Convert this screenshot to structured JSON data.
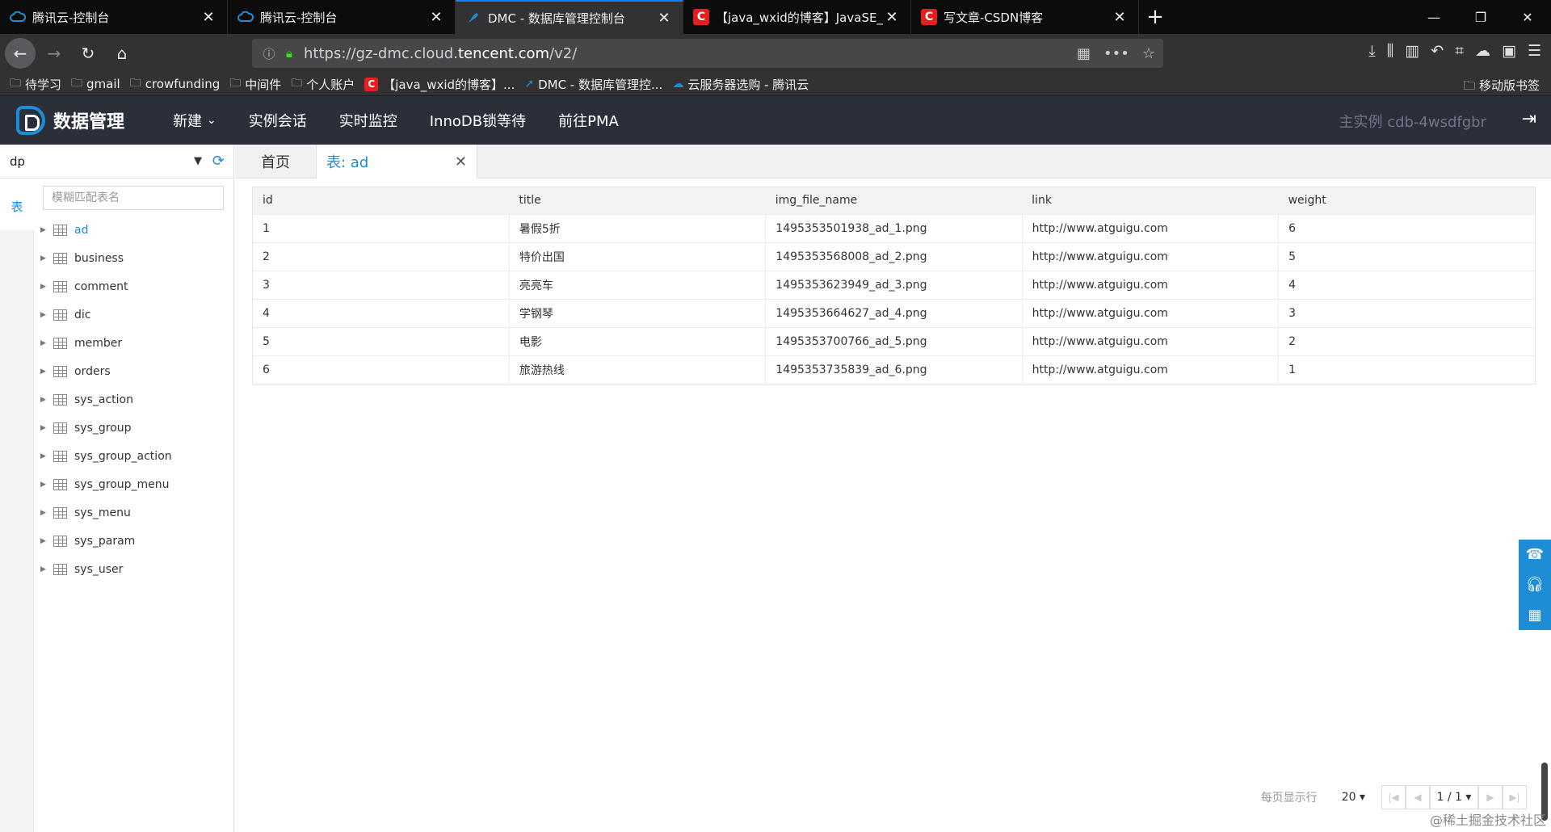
{
  "browser": {
    "tabs": [
      {
        "label": "腾讯云-控制台",
        "icon": "cloud-icon"
      },
      {
        "label": "腾讯云-控制台",
        "icon": "cloud-icon"
      },
      {
        "label": "DMC - 数据库管理控制台",
        "icon": "dmc-icon"
      },
      {
        "label": "【java_wxid的博客】JavaSE_N",
        "icon": "csdn-icon"
      },
      {
        "label": "写文章-CSDN博客",
        "icon": "csdn-icon"
      }
    ],
    "url_prefix": "https://gz-dmc.cloud.",
    "url_domain": "tencent.com",
    "url_suffix": "/v2/",
    "bookmarks": [
      "待学习",
      "gmail",
      "crowfunding",
      "中间件",
      "个人账户",
      "【java_wxid的博客】...",
      "DMC - 数据库管理控...",
      "云服务器选购 - 腾讯云"
    ],
    "mobile_bookmarks": "移动版书签"
  },
  "app": {
    "logo_text": "数据管理",
    "nav": {
      "new": "新建",
      "sessions": "实例会话",
      "monitor": "实时监控",
      "innodb": "InnoDB锁等待",
      "pma": "前往PMA"
    },
    "instance": "主实例 cdb-4wsdfgbr"
  },
  "sidebar": {
    "db": "dp",
    "vtab": "表",
    "search_placeholder": "模糊匹配表名",
    "tables": [
      "ad",
      "business",
      "comment",
      "dic",
      "member",
      "orders",
      "sys_action",
      "sys_group",
      "sys_group_action",
      "sys_group_menu",
      "sys_menu",
      "sys_param",
      "sys_user"
    ]
  },
  "main": {
    "home_tab": "首页",
    "table_tab": "表: ad",
    "columns": [
      "id",
      "title",
      "img_file_name",
      "link",
      "weight"
    ],
    "rows": [
      [
        "1",
        "暑假5折",
        "1495353501938_ad_1.png",
        "http://www.atguigu.com",
        "6"
      ],
      [
        "2",
        "特价出国",
        "1495353568008_ad_2.png",
        "http://www.atguigu.com",
        "5"
      ],
      [
        "3",
        "亮亮车",
        "1495353623949_ad_3.png",
        "http://www.atguigu.com",
        "4"
      ],
      [
        "4",
        "学钢琴",
        "1495353664627_ad_4.png",
        "http://www.atguigu.com",
        "3"
      ],
      [
        "5",
        "电影",
        "1495353700766_ad_5.png",
        "http://www.atguigu.com",
        "2"
      ],
      [
        "6",
        "旅游热线",
        "1495353735839_ad_6.png",
        "http://www.atguigu.com",
        "1"
      ]
    ],
    "pager": {
      "label": "每页显示行",
      "per_page": "20",
      "page": "1 / 1"
    }
  },
  "watermark": "@稀土掘金技术社区",
  "colors": {
    "accent": "#1f8dd6",
    "header_bg": "#2b2f3a",
    "chrome_bg": "#323234"
  }
}
